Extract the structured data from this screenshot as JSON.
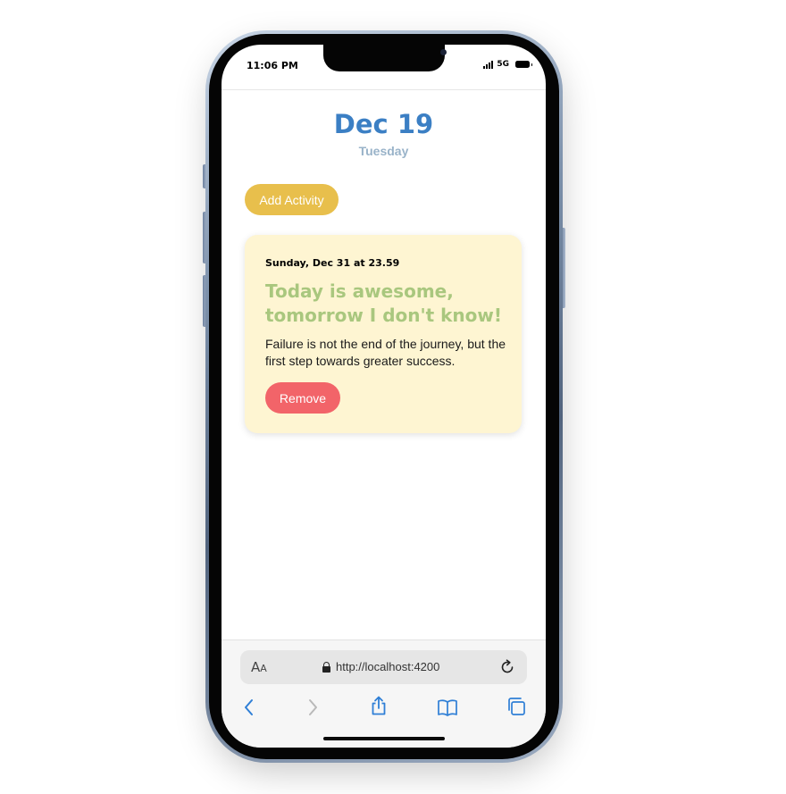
{
  "status_bar": {
    "time": "11:06 PM",
    "network": "5G"
  },
  "header": {
    "date": "Dec 19",
    "weekday": "Tuesday"
  },
  "actions": {
    "add_label": "Add Activity"
  },
  "activity": {
    "due": "Sunday, Dec 31 at 23.59",
    "title": "Today is awesome, tomorrow I don't know!",
    "description": "Failure is not the end of the journey, but the first step towards greater success.",
    "remove_label": "Remove"
  },
  "browser": {
    "text_size_label_large": "A",
    "text_size_label_small": "A",
    "url": "http://localhost:4200"
  },
  "colors": {
    "date_title": "#3b7fc4",
    "weekday": "#99b3c9",
    "add_button": "#e8bf4c",
    "card_background": "#fef5d2",
    "card_title": "#a9c77e",
    "remove_button": "#f26469",
    "toolbar_icons": "#2f7fd6"
  },
  "icons": [
    "lock-icon",
    "reload-icon",
    "back-icon",
    "forward-icon",
    "share-icon",
    "bookmarks-icon",
    "tabs-icon"
  ]
}
